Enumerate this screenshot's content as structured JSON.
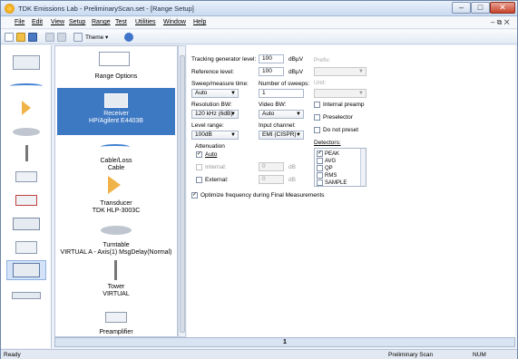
{
  "window": {
    "title": "TDK Emissions Lab - PreliminaryScan.set - [Range Setup]",
    "min": "–",
    "max": "□",
    "close": "✕"
  },
  "menu": [
    "File",
    "Edit",
    "View",
    "Setup",
    "Range",
    "Test",
    "Utilities",
    "Window",
    "Help"
  ],
  "mdi_controls": "– ⧉ ✕",
  "toolbar": {
    "theme_label": "Theme ▾"
  },
  "pane_items": [
    {
      "label": "Range Options"
    },
    {
      "label": "Receiver\nHP/Agilent E4403B",
      "selected": true
    },
    {
      "label": "Cable/Loss\nCable"
    },
    {
      "label": "Transducer\nTDK HLP-3003C"
    },
    {
      "label": "Turntable\nVIRTUAL A - Axis(1) MsgDelay(Normal)"
    },
    {
      "label": "Tower\nVIRTUAL"
    },
    {
      "label": "Preamplifier"
    }
  ],
  "form": {
    "tracking_label": "Tracking generator level:",
    "tracking_value": "100",
    "tracking_unit": "dBµV",
    "reference_label": "Reference level:",
    "reference_value": "100",
    "reference_unit": "dBµV",
    "sweep_label": "Sweep/measure time:",
    "sweep_value": "Auto",
    "numsweeps_label": "Number of sweeps:",
    "numsweeps_value": "1",
    "rbw_label": "Resolution BW:",
    "rbw_value": "120 kHz (6dB)",
    "vbw_label": "Video BW:",
    "vbw_value": "Auto",
    "range_label": "Level range:",
    "range_value": "100dB",
    "channel_label": "Input channel:",
    "channel_value": "EMI (CISPR)",
    "atten_label": "Attenuation",
    "atten_auto": "Auto",
    "atten_internal": "Internal:",
    "atten_internal_value": "0",
    "atten_external": "External:",
    "atten_external_value": "0",
    "atten_unit": "dB",
    "optimize_label": "Optimize frequency during Final Measurements",
    "prefix_label": "Prefix:",
    "unit_label": "Unit:",
    "internal_preamp": "Internal preamp",
    "preselector": "Preselector",
    "no_preset": "Do not preset",
    "detectors_label": "Detectors:",
    "detectors": [
      {
        "name": "PEAK",
        "checked": true
      },
      {
        "name": "AVG",
        "checked": false
      },
      {
        "name": "QP",
        "checked": false
      },
      {
        "name": "RMS",
        "checked": false
      },
      {
        "name": "SAMPLE",
        "checked": false
      }
    ]
  },
  "page_number": "1",
  "status": {
    "left": "Ready",
    "mode": "Preliminary Scan",
    "num": "NUM"
  }
}
